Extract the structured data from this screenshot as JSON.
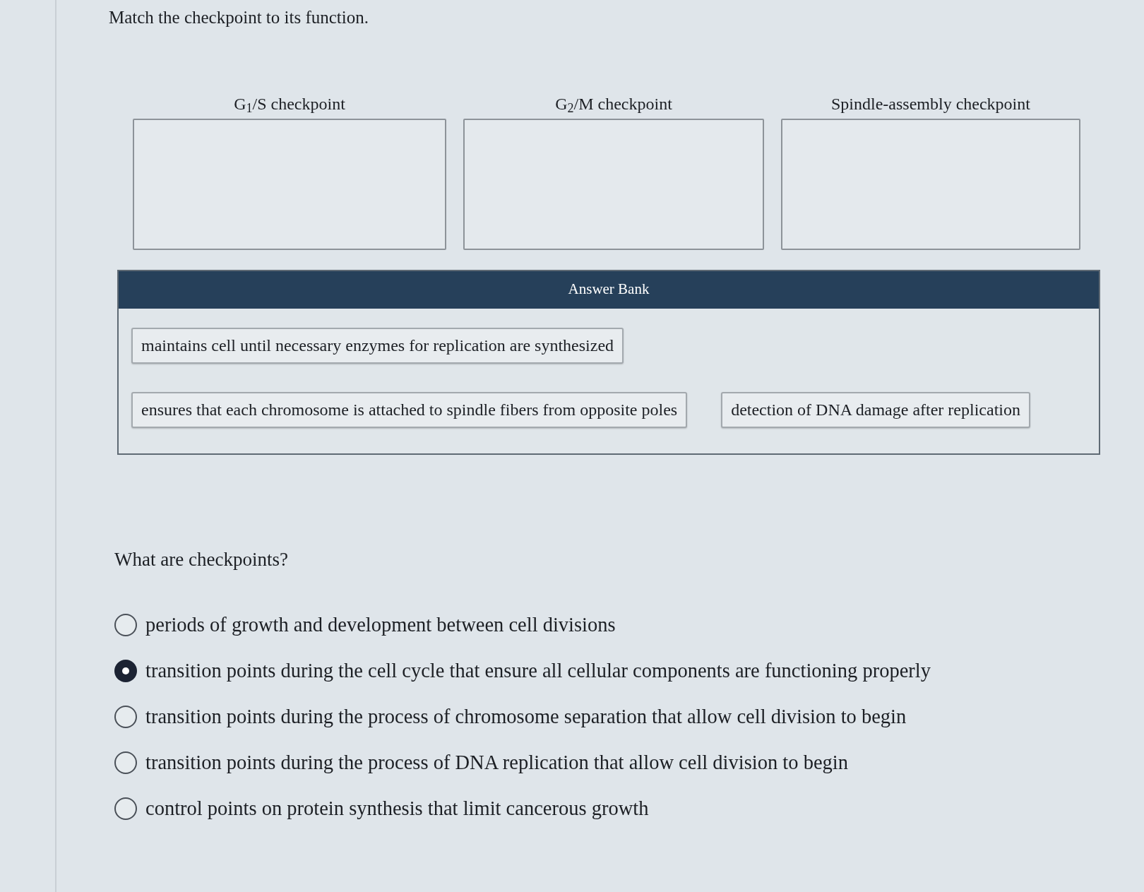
{
  "prompt": "Match the checkpoint to its function.",
  "targets": [
    {
      "label": "G$_{1}$/S checkpoint"
    },
    {
      "label": "G$_{2}$/M checkpoint"
    },
    {
      "label": "Spindle-assembly checkpoint"
    }
  ],
  "answer_bank": {
    "title": "Answer Bank",
    "rows": [
      {
        "items": [
          "maintains cell until necessary enzymes for replication are synthesized"
        ]
      },
      {
        "items": [
          "ensures that each chromosome is attached to spindle fibers from opposite poles",
          "detection of DNA damage after replication"
        ]
      }
    ]
  },
  "question": {
    "text": "What are checkpoints?",
    "options": [
      {
        "label": "periods of growth and development between cell divisions",
        "selected": false
      },
      {
        "label": "transition points during the cell cycle that ensure all cellular components are functioning properly",
        "selected": true
      },
      {
        "label": "transition points during the process of chromosome separation that allow cell division to begin",
        "selected": false
      },
      {
        "label": "transition points during the process of DNA replication that allow cell division to begin",
        "selected": false
      },
      {
        "label": "control points on protein synthesis that limit cancerous growth",
        "selected": false
      }
    ]
  }
}
